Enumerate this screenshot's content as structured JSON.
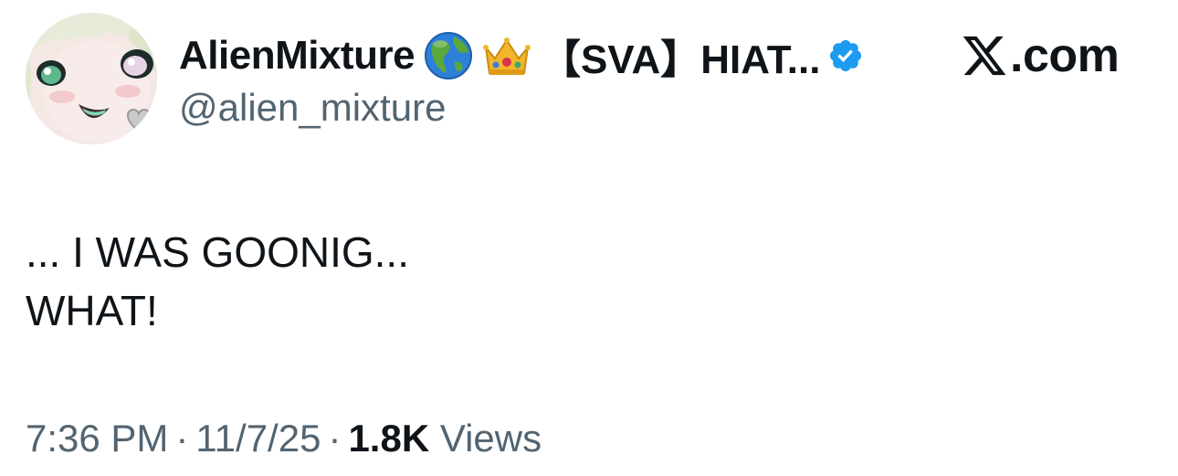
{
  "author": {
    "display_name": "AlienMixture",
    "name_suffix": "【SVA】HIAT...",
    "handle": "@alien_mixture",
    "emojis": [
      "globe-americas-emoji",
      "crown-emoji"
    ],
    "verified": true
  },
  "brand": {
    "text": ".com",
    "icon": "x-logo-icon"
  },
  "tweet": {
    "lines": [
      "... I WAS GOONIG...",
      "WHAT!"
    ]
  },
  "meta": {
    "time": "7:36 PM",
    "separator": "·",
    "date": "11/7/25",
    "views_count": "1.8K",
    "views_label": "Views"
  },
  "colors": {
    "text_primary": "#0f1419",
    "text_secondary": "#536471",
    "verified_blue": "#1d9bf0"
  }
}
